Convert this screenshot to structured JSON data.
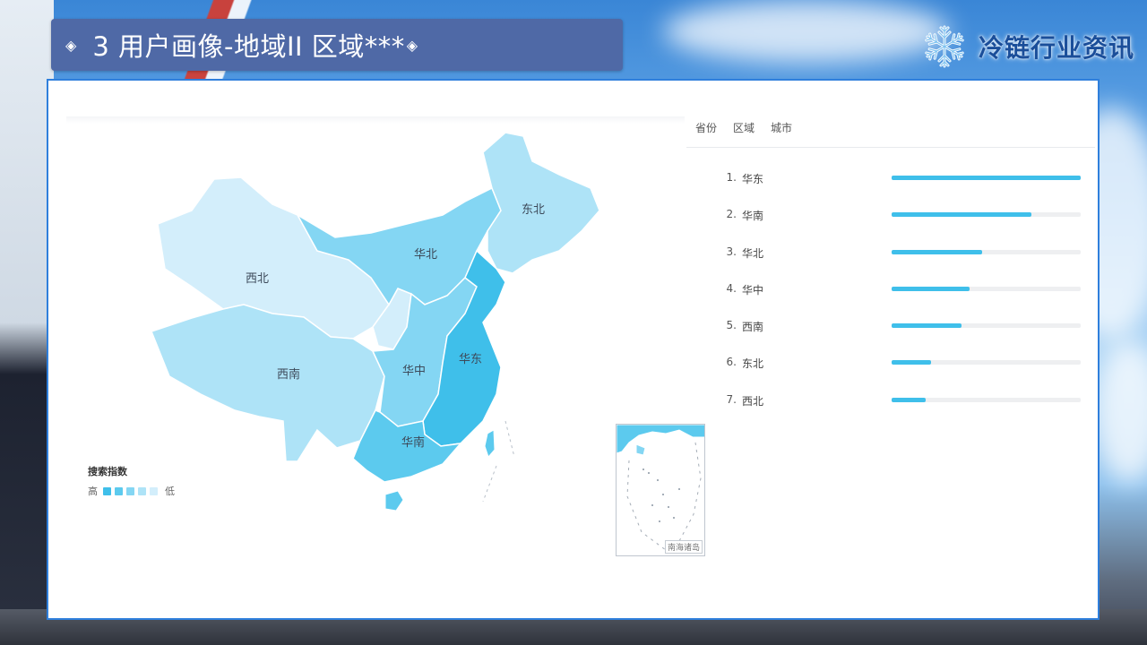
{
  "header": {
    "title": "3 用户画像-地域II 区域***",
    "diamond": "◈",
    "brand": "冷链行业资讯",
    "brand_icon": "snowflake-icon"
  },
  "map": {
    "region_labels": [
      "西北",
      "华北",
      "东北",
      "西南",
      "华中",
      "华东",
      "华南"
    ],
    "inset_label": "南海诸岛",
    "legend_title": "搜索指数",
    "legend_high": "高",
    "legend_low": "低",
    "legend_colors": [
      "#3fbfea",
      "#5ccaee",
      "#84d6f3",
      "#aee3f7",
      "#d3eefb"
    ]
  },
  "tabs": [
    "省份",
    "区域",
    "城市"
  ],
  "chart_data": {
    "type": "bar",
    "orientation": "horizontal",
    "categories": [
      "华东",
      "华南",
      "华北",
      "华中",
      "西南",
      "东北",
      "西北"
    ],
    "ranks": [
      "1.",
      "2.",
      "3.",
      "4.",
      "5.",
      "6.",
      "7."
    ],
    "values": [
      100,
      74,
      48,
      41,
      37,
      21,
      18
    ],
    "xlim": [
      0,
      100
    ],
    "bar_color": "#3fbfea",
    "track_color": "#eeeff1"
  }
}
